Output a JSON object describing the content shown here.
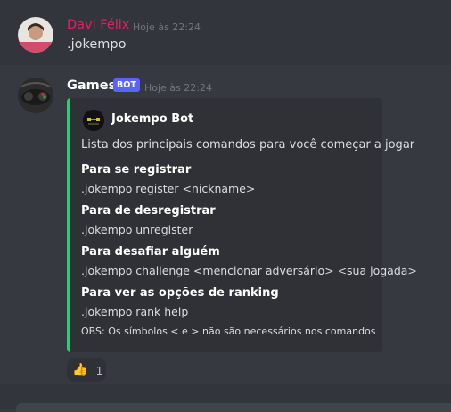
{
  "messages": [
    {
      "username": "Davi Félix",
      "username_color": "#e91e63",
      "timestamp": "Hoje às 22:24",
      "content": ".jokempo"
    },
    {
      "username": "Games",
      "username_color": "#ffffff",
      "bot_tag": "BOT",
      "timestamp": "Hoje às 22:24",
      "embed": {
        "color": "#2ecc71",
        "author": "Jokempo Bot",
        "description": "Lista dos principais comandos para você começar a jogar",
        "fields": [
          {
            "name": "Para se registrar",
            "value": ".jokempo register <nickname>"
          },
          {
            "name": "Para de desregistrar",
            "value": ".jokempo unregister"
          },
          {
            "name": "Para desafiar alguém",
            "value": ".jokempo challenge <mencionar adversário> <sua jogada>"
          },
          {
            "name": "Para ver as opções de ranking",
            "value": ".jokempo rank help"
          }
        ],
        "footer": "OBS: Os símbolos < e > não são necessários nos comandos"
      },
      "reactions": [
        {
          "emoji": "👍",
          "count": "1"
        }
      ]
    }
  ]
}
